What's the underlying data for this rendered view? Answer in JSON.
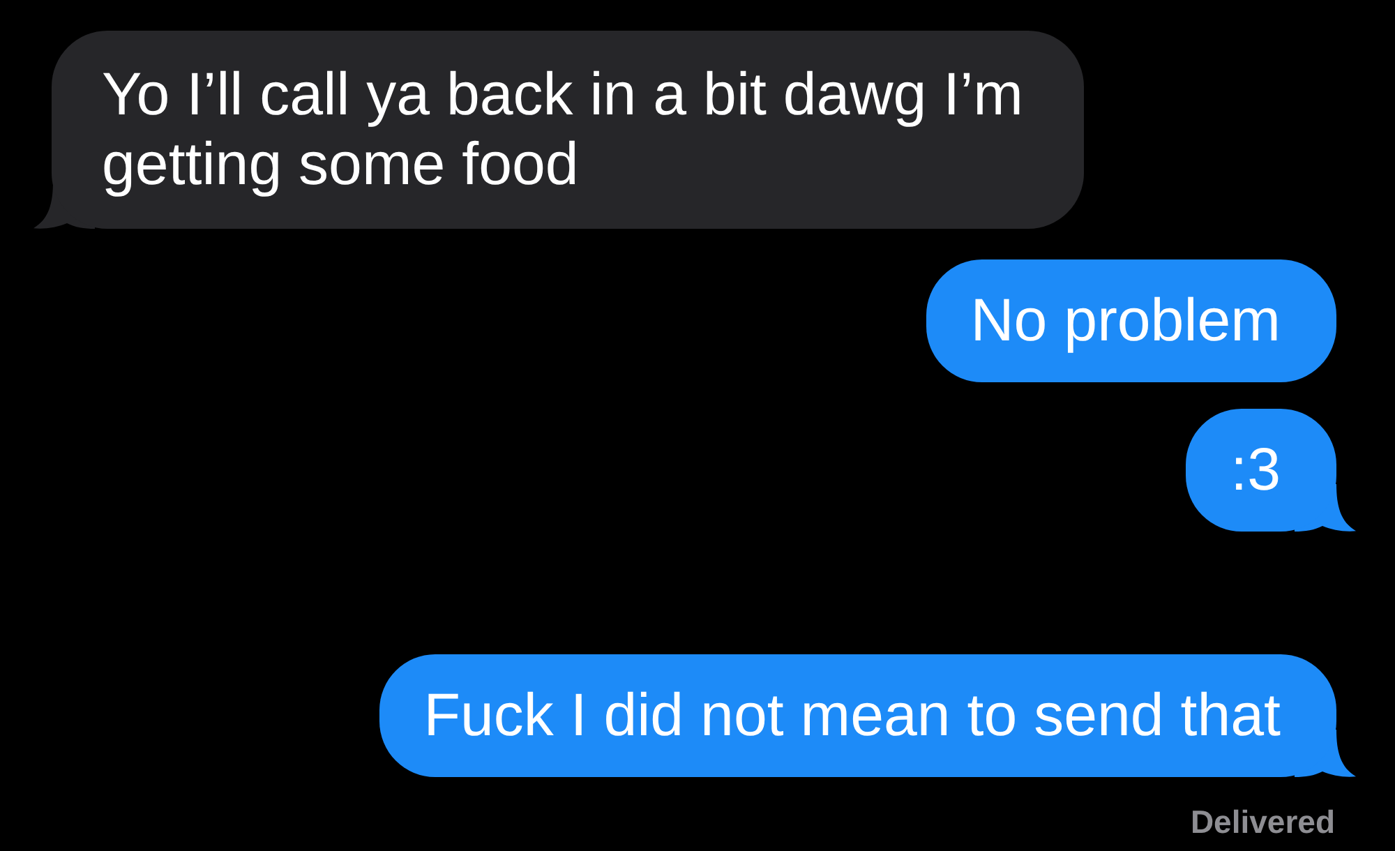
{
  "messages": [
    {
      "kind": "received",
      "tail": true,
      "text": "Yo I’ll call ya back in a bit dawg I’m getting some food"
    },
    {
      "kind": "sent",
      "tail": false,
      "text": "No problem"
    },
    {
      "kind": "sent",
      "tail": true,
      "text": ":3"
    },
    {
      "kind": "sent",
      "tail": true,
      "text": "Fuck I did not mean to send that"
    }
  ],
  "status": "Delivered"
}
